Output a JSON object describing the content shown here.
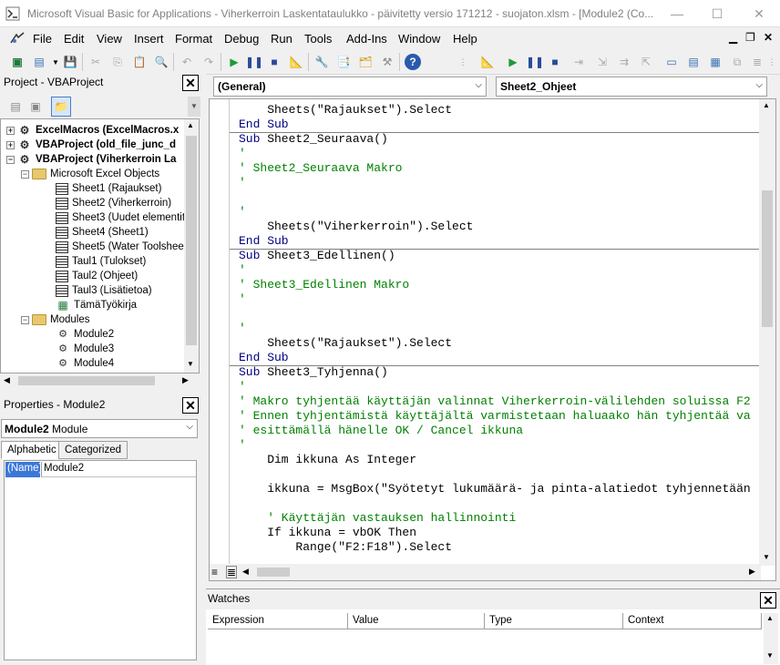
{
  "window": {
    "title": "Microsoft Visual Basic for Applications - Viherkerroin Laskentataulukko - päivitetty versio 171212 - suojaton.xlsm - [Module2 (Co..."
  },
  "menu": {
    "items": [
      "File",
      "Edit",
      "View",
      "Insert",
      "Format",
      "Debug",
      "Run",
      "Tools",
      "Add-Ins",
      "Window",
      "Help"
    ]
  },
  "project": {
    "title": "Project - VBAProject",
    "tree": [
      {
        "label": "ExcelMacros (ExcelMacros.x",
        "bold": true
      },
      {
        "label": "VBAProject (old_file_junc_d",
        "bold": true
      },
      {
        "label": "VBAProject (Viherkerroin La",
        "bold": true
      },
      {
        "label": "Microsoft Excel Objects",
        "bold": false
      },
      {
        "label": "Sheet1 (Rajaukset)",
        "bold": false
      },
      {
        "label": "Sheet2 (Viherkerroin)",
        "bold": false
      },
      {
        "label": "Sheet3 (Uudet elementit",
        "bold": false
      },
      {
        "label": "Sheet4 (Sheet1)",
        "bold": false
      },
      {
        "label": "Sheet5 (Water Toolshee",
        "bold": false
      },
      {
        "label": "Taul1 (Tulokset)",
        "bold": false
      },
      {
        "label": "Taul2 (Ohjeet)",
        "bold": false
      },
      {
        "label": "Taul3 (Lisätietoa)",
        "bold": false
      },
      {
        "label": "TämäTyökirja",
        "bold": false
      },
      {
        "label": "Modules",
        "bold": false
      },
      {
        "label": "Module2",
        "bold": false
      },
      {
        "label": "Module3",
        "bold": false
      },
      {
        "label": "Module4",
        "bold": false
      }
    ]
  },
  "properties": {
    "title": "Properties - Module2",
    "object_bold": "Module2",
    "object_rest": " Module",
    "tab_alphabetic": "Alphabetic",
    "tab_categorized": "Categorized",
    "prop_name": "(Name)",
    "prop_value": "Module2"
  },
  "code": {
    "object_combo": "(General)",
    "procedure_combo": "Sheet2_Ohjeet",
    "lines": [
      {
        "text": "    Sheets(\"Rajaukset\").Select",
        "kind": "code"
      },
      {
        "text": "End Sub",
        "kind": "kw"
      },
      {
        "text": "Sub Sheet2_Seuraava()",
        "kind": "kw"
      },
      {
        "text": "'",
        "kind": "cm"
      },
      {
        "text": "' Sheet2_Seuraava Makro",
        "kind": "cm"
      },
      {
        "text": "'",
        "kind": "cm"
      },
      {
        "text": "",
        "kind": "code"
      },
      {
        "text": "'",
        "kind": "cm"
      },
      {
        "text": "    Sheets(\"Viherkerroin\").Select",
        "kind": "code"
      },
      {
        "text": "End Sub",
        "kind": "kw"
      },
      {
        "text": "Sub Sheet3_Edellinen()",
        "kind": "kw"
      },
      {
        "text": "'",
        "kind": "cm"
      },
      {
        "text": "' Sheet3_Edellinen Makro",
        "kind": "cm"
      },
      {
        "text": "'",
        "kind": "cm"
      },
      {
        "text": "",
        "kind": "code"
      },
      {
        "text": "'",
        "kind": "cm"
      },
      {
        "text": "    Sheets(\"Rajaukset\").Select",
        "kind": "code"
      },
      {
        "text": "End Sub",
        "kind": "kw"
      },
      {
        "text": "Sub Sheet3_Tyhjenna()",
        "kind": "kw"
      },
      {
        "text": "'",
        "kind": "cm"
      },
      {
        "text": "' Makro tyhjentää käyttäjän valinnat Viherkerroin-välilehden soluissa F2",
        "kind": "cm"
      },
      {
        "text": "' Ennen tyhjentämistä käyttäjältä varmistetaan haluaako hän tyhjentää va",
        "kind": "cm"
      },
      {
        "text": "' esittämällä hänelle OK / Cancel ikkuna",
        "kind": "cm"
      },
      {
        "text": "'",
        "kind": "cm"
      },
      {
        "text": "    Dim ikkuna As Integer",
        "kind": "code"
      },
      {
        "text": "",
        "kind": "code"
      },
      {
        "text": "    ikkuna = MsgBox(\"Syötetyt lukumäärä- ja pinta-alatiedot tyhjennetään",
        "kind": "code"
      },
      {
        "text": "",
        "kind": "code"
      },
      {
        "text": "    ' Käyttäjän vastauksen hallinnointi",
        "kind": "cm"
      },
      {
        "text": "    If ikkuna = vbOK Then",
        "kind": "code"
      },
      {
        "text": "        Range(\"F2:F18\").Select",
        "kind": "code"
      }
    ]
  },
  "watches": {
    "title": "Watches",
    "columns": [
      "Expression",
      "Value",
      "Type",
      "Context"
    ]
  }
}
